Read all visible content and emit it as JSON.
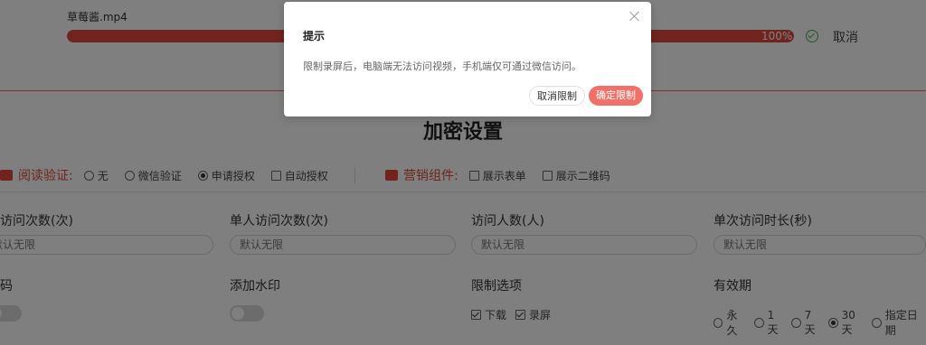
{
  "upload": {
    "file_name": "草莓酱.mp4",
    "progress_percent": 100,
    "progress_label": "100%",
    "cancel_label": "取消"
  },
  "settings": {
    "title": "加密设置",
    "read_verify": {
      "label": "阅读验证:",
      "options": [
        "无",
        "微信验证",
        "申请授权",
        "自动授权"
      ],
      "selected": "申请授权"
    },
    "marketing": {
      "label": "营销组件:",
      "options": [
        "展示表单",
        "展示二维码"
      ]
    },
    "fields": {
      "visit_count": {
        "label": "访问次数(次)",
        "placeholder": "默认无限"
      },
      "single_visit_count": {
        "label": "单人访问次数(次)",
        "placeholder": "默认无限"
      },
      "visitor_count": {
        "label": "访问人数(人)",
        "placeholder": "默认无限"
      },
      "single_duration": {
        "label": "单次访问时长(秒)",
        "placeholder": "默认无限"
      }
    },
    "password": {
      "label": "码"
    },
    "watermark": {
      "label": "添加水印"
    },
    "restrict": {
      "label": "限制选项",
      "options": [
        "下载",
        "录屏"
      ]
    },
    "validity": {
      "label": "有效期",
      "options": [
        "永久",
        "1天",
        "7天",
        "30天",
        "指定日期"
      ],
      "selected": "30天"
    }
  },
  "dialog": {
    "title": "提示",
    "message": "限制录屏后，电脑端无法访问视频，手机端仅可通过微信访问。",
    "cancel_button": "取消限制",
    "confirm_button": "确定限制"
  },
  "colors": {
    "accent": "#e3483a",
    "confirm": "#f0706a",
    "success": "#39b54a"
  }
}
